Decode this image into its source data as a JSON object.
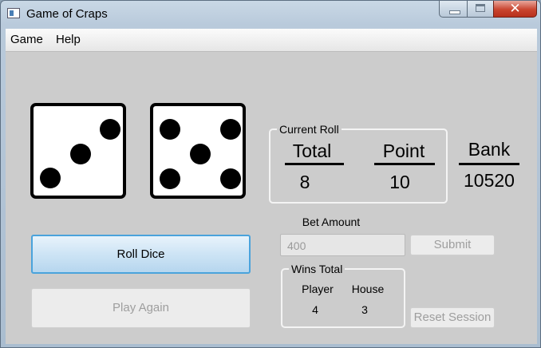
{
  "window": {
    "title": "Game of Craps"
  },
  "menu": {
    "items": [
      "Game",
      "Help"
    ]
  },
  "dice": {
    "die1": 3,
    "die2": 5
  },
  "current_roll": {
    "group_title": "Current Roll",
    "total_label": "Total",
    "total_value": "8",
    "point_label": "Point",
    "point_value": "10"
  },
  "bank": {
    "label": "Bank",
    "value": "10520"
  },
  "bet": {
    "label": "Bet Amount",
    "value": "400",
    "submit_label": "Submit"
  },
  "wins": {
    "group_title": "Wins Total",
    "player_label": "Player",
    "player_value": "4",
    "house_label": "House",
    "house_value": "3"
  },
  "buttons": {
    "roll": "Roll Dice",
    "play_again": "Play Again",
    "reset": "Reset Session"
  },
  "colors": {
    "focus_accent": "#4aa3dc",
    "close_button": "#c9452f"
  }
}
